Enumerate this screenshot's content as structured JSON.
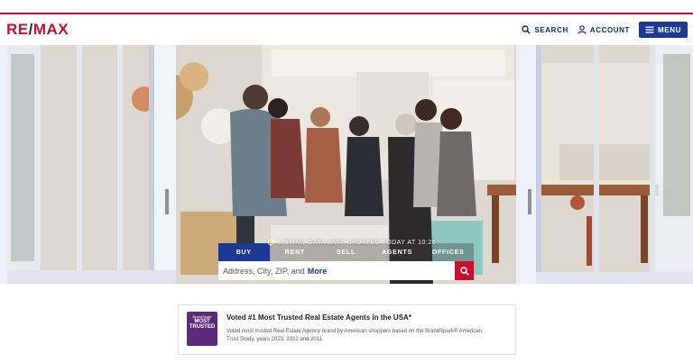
{
  "brand": {
    "re": "RE",
    "slash": "/",
    "max": "MAX"
  },
  "nav": {
    "search_label": "SEARCH",
    "account_label": "ACCOUNT",
    "menu_label": "MENU"
  },
  "search": {
    "tabs": [
      {
        "label": "BUY",
        "active": true
      },
      {
        "label": "RENT",
        "active": false
      },
      {
        "label": "SELL",
        "active": false
      },
      {
        "label": "AGENTS",
        "active": false
      },
      {
        "label": "OFFICES",
        "active": false
      }
    ],
    "placeholder": "Address, City, ZIP, and",
    "placeholder_more": "More",
    "listing_note": "LISTING DATA LAST UPDATED TODAY AT 10:26"
  },
  "trust": {
    "badge_top": "BrandSpark",
    "badge_main": "MOST TRUSTED",
    "title": "Voted #1 Most Trusted Real Estate Agents in the USA*",
    "body": "Voted most trusted Real Estate Agency brand by American shoppers based on the BrandSpark® American Trust Study, years 2023, 2022 and 2011."
  },
  "colors": {
    "brand_red": "#c8102e",
    "brand_blue": "#1b3a94",
    "navy": "#0a2d6e"
  }
}
